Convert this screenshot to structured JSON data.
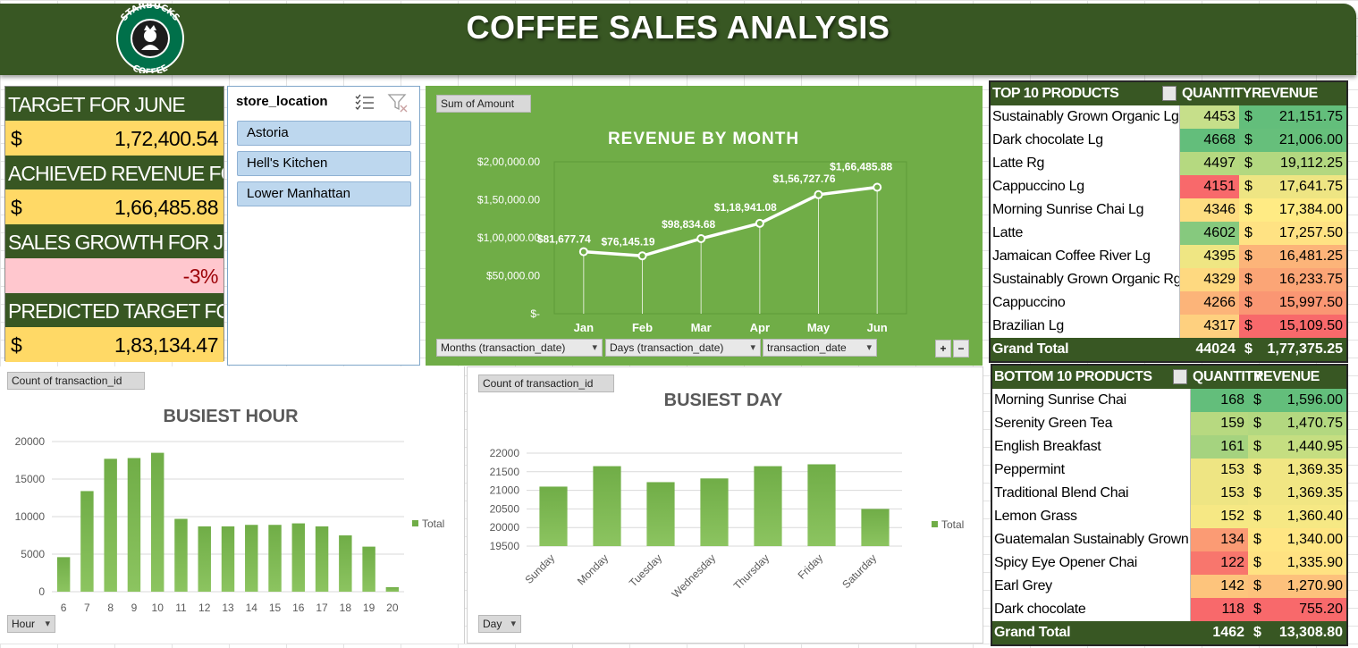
{
  "header": {
    "title": "COFFEE SALES ANALYSIS",
    "logo_text_top": "STARBUCKS",
    "logo_text_bottom": "COFFEE"
  },
  "kpis": [
    {
      "label": "TARGET FOR JUNE",
      "currency": "$",
      "value": "1,72,400.54"
    },
    {
      "label": "ACHIEVED REVENUE FOR JUNE",
      "currency": "$",
      "value": "1,66,485.88"
    },
    {
      "label": "SALES GROWTH FOR JUNE",
      "currency": "",
      "value": "-3%"
    },
    {
      "label": "PREDICTED TARGET FOR JULY",
      "currency": "$",
      "value": "1,83,134.47"
    }
  ],
  "slicer": {
    "title": "store_location",
    "items": [
      "Astoria",
      "Hell's Kitchen",
      "Lower Manhattan"
    ]
  },
  "revenue_chart": {
    "value_field": "Sum of Amount",
    "filters": [
      "Months (transaction_date)",
      "Days (transaction_date)",
      "transaction_date"
    ],
    "expand_label": "+",
    "collapse_label": "−"
  },
  "hour_chart": {
    "value_field": "Count of transaction_id",
    "axis_field": "Hour"
  },
  "day_chart": {
    "value_field": "Count of transaction_id",
    "axis_field": "Day"
  },
  "top_table": {
    "headers": [
      "TOP 10 PRODUCTS",
      "QUANTITY",
      "REVENUE"
    ],
    "rows": [
      {
        "name": "Sustainably Grown Organic Lg",
        "qty": "4453",
        "cur": "$",
        "rev": "21,151.75",
        "qty_color": "#c6df8a",
        "rev_color": "#63be7b"
      },
      {
        "name": "Dark chocolate Lg",
        "qty": "4668",
        "cur": "$",
        "rev": "21,006.00",
        "qty_color": "#63be7b",
        "rev_color": "#66bf7b"
      },
      {
        "name": "Latte Rg",
        "qty": "4497",
        "cur": "$",
        "rev": "19,112.25",
        "qty_color": "#b5d980",
        "rev_color": "#b3d880"
      },
      {
        "name": "Cappuccino Lg",
        "qty": "4151",
        "cur": "$",
        "rev": "17,641.75",
        "qty_color": "#f8696b",
        "rev_color": "#eee583"
      },
      {
        "name": "Morning Sunrise Chai Lg",
        "qty": "4346",
        "cur": "$",
        "rev": "17,384.00",
        "qty_color": "#fedd81",
        "rev_color": "#ffeb84"
      },
      {
        "name": "Latte",
        "qty": "4602",
        "cur": "$",
        "rev": "17,257.50",
        "qty_color": "#86c97e",
        "rev_color": "#ffe283"
      },
      {
        "name": "Jamaican Coffee River Lg",
        "qty": "4395",
        "cur": "$",
        "rev": "16,481.25",
        "qty_color": "#efe683",
        "rev_color": "#fcb479"
      },
      {
        "name": "Sustainably Grown Organic Rg",
        "qty": "4329",
        "cur": "$",
        "rev": "16,233.75",
        "qty_color": "#fed980",
        "rev_color": "#fba576"
      },
      {
        "name": "Cappuccino",
        "qty": "4266",
        "cur": "$",
        "rev": "15,997.50",
        "qty_color": "#fcb479",
        "rev_color": "#fa9673"
      },
      {
        "name": "Brazilian Lg",
        "qty": "4317",
        "cur": "$",
        "rev": "15,109.50",
        "qty_color": "#fed07f",
        "rev_color": "#f8696b"
      }
    ],
    "grand_total": {
      "label": "Grand Total",
      "qty": "44024",
      "cur": "$",
      "rev": "1,77,375.25"
    }
  },
  "bottom_table": {
    "headers": [
      "BOTTOM 10 PRODUCTS",
      "QUANTITY",
      "REVENUE"
    ],
    "rows": [
      {
        "name": "Morning Sunrise Chai",
        "qty": "168",
        "cur": "$",
        "rev": "1,596.00",
        "qty_color": "#63be7b",
        "rev_color": "#63be7b"
      },
      {
        "name": "Serenity Green Tea",
        "qty": "159",
        "cur": "$",
        "rev": "1,470.75",
        "qty_color": "#b7d980",
        "rev_color": "#b3d880"
      },
      {
        "name": "English Breakfast",
        "qty": "161",
        "cur": "$",
        "rev": "1,440.95",
        "qty_color": "#a5d37f",
        "rev_color": "#c5de81"
      },
      {
        "name": "Peppermint",
        "qty": "153",
        "cur": "$",
        "rev": "1,369.35",
        "qty_color": "#eee583",
        "rev_color": "#f1e683"
      },
      {
        "name": "Traditional Blend Chai",
        "qty": "153",
        "cur": "$",
        "rev": "1,369.35",
        "qty_color": "#eee583",
        "rev_color": "#f1e683"
      },
      {
        "name": "Lemon Grass",
        "qty": "152",
        "cur": "$",
        "rev": "1,360.40",
        "qty_color": "#f6e884",
        "rev_color": "#f6e884"
      },
      {
        "name": "Guatemalan Sustainably Grown",
        "qty": "134",
        "cur": "$",
        "rev": "1,340.00",
        "qty_color": "#fb9b74",
        "rev_color": "#ffe683"
      },
      {
        "name": "Spicy Eye Opener Chai",
        "qty": "122",
        "cur": "$",
        "rev": "1,335.90",
        "qty_color": "#f8766d",
        "rev_color": "#ffe282"
      },
      {
        "name": "Earl Grey",
        "qty": "142",
        "cur": "$",
        "rev": "1,270.90",
        "qty_color": "#fdc47c",
        "rev_color": "#fdc17c"
      },
      {
        "name": "Dark chocolate",
        "qty": "118",
        "cur": "$",
        "rev": "755.20",
        "qty_color": "#f8696b",
        "rev_color": "#f8696b"
      }
    ],
    "grand_total": {
      "label": "Grand Total",
      "qty": "1462",
      "cur": "$",
      "rev": "13,308.80"
    }
  },
  "colors": {
    "header_green": "#385723",
    "chart_green": "#70ad47",
    "bar_green": "#70ad47",
    "kpi_yellow": "#ffd966",
    "kpi_pink": "#ffc7ce",
    "slicer_blue": "#bdd7ee"
  },
  "chart_data": [
    {
      "type": "line",
      "title": "REVENUE BY MONTH",
      "categories": [
        "Jan",
        "Feb",
        "Mar",
        "Apr",
        "May",
        "Jun"
      ],
      "values": [
        81677.74,
        76145.19,
        98834.68,
        118941.08,
        156727.76,
        166485.88
      ],
      "data_labels": [
        "$81,677.74",
        "$76,145.19",
        "$98,834.68",
        "$1,18,941.08",
        "$1,56,727.76",
        "$1,66,485.88"
      ],
      "y_ticks": [
        0,
        50000,
        100000,
        150000,
        200000
      ],
      "y_tick_labels": [
        "$-",
        "$50,000.00",
        "$1,00,000.00",
        "$1,50,000.00",
        "$2,00,000.00"
      ],
      "ylim": [
        0,
        200000
      ],
      "grid": false
    },
    {
      "type": "bar",
      "title": "BUSIEST HOUR",
      "categories": [
        "6",
        "7",
        "8",
        "9",
        "10",
        "11",
        "12",
        "13",
        "14",
        "15",
        "16",
        "17",
        "18",
        "19",
        "20"
      ],
      "series": [
        {
          "name": "Total",
          "values": [
            4600,
            13400,
            17700,
            17800,
            18500,
            9700,
            8700,
            8700,
            8900,
            8900,
            9100,
            8700,
            7500,
            6000,
            600
          ]
        }
      ],
      "y_ticks": [
        0,
        5000,
        10000,
        15000,
        20000
      ],
      "ylim": [
        0,
        20000
      ],
      "grid": true,
      "legend": "right"
    },
    {
      "type": "bar",
      "title": "BUSIEST DAY",
      "categories": [
        "Sunday",
        "Monday",
        "Tuesday",
        "Wednesday",
        "Thursday",
        "Friday",
        "Saturday"
      ],
      "series": [
        {
          "name": "Total",
          "values": [
            21100,
            21650,
            21220,
            21320,
            21650,
            21700,
            20500
          ]
        }
      ],
      "y_ticks": [
        19500,
        20000,
        20500,
        21000,
        21500,
        22000
      ],
      "ylim": [
        19500,
        22000
      ],
      "grid": true,
      "legend": "right"
    }
  ]
}
